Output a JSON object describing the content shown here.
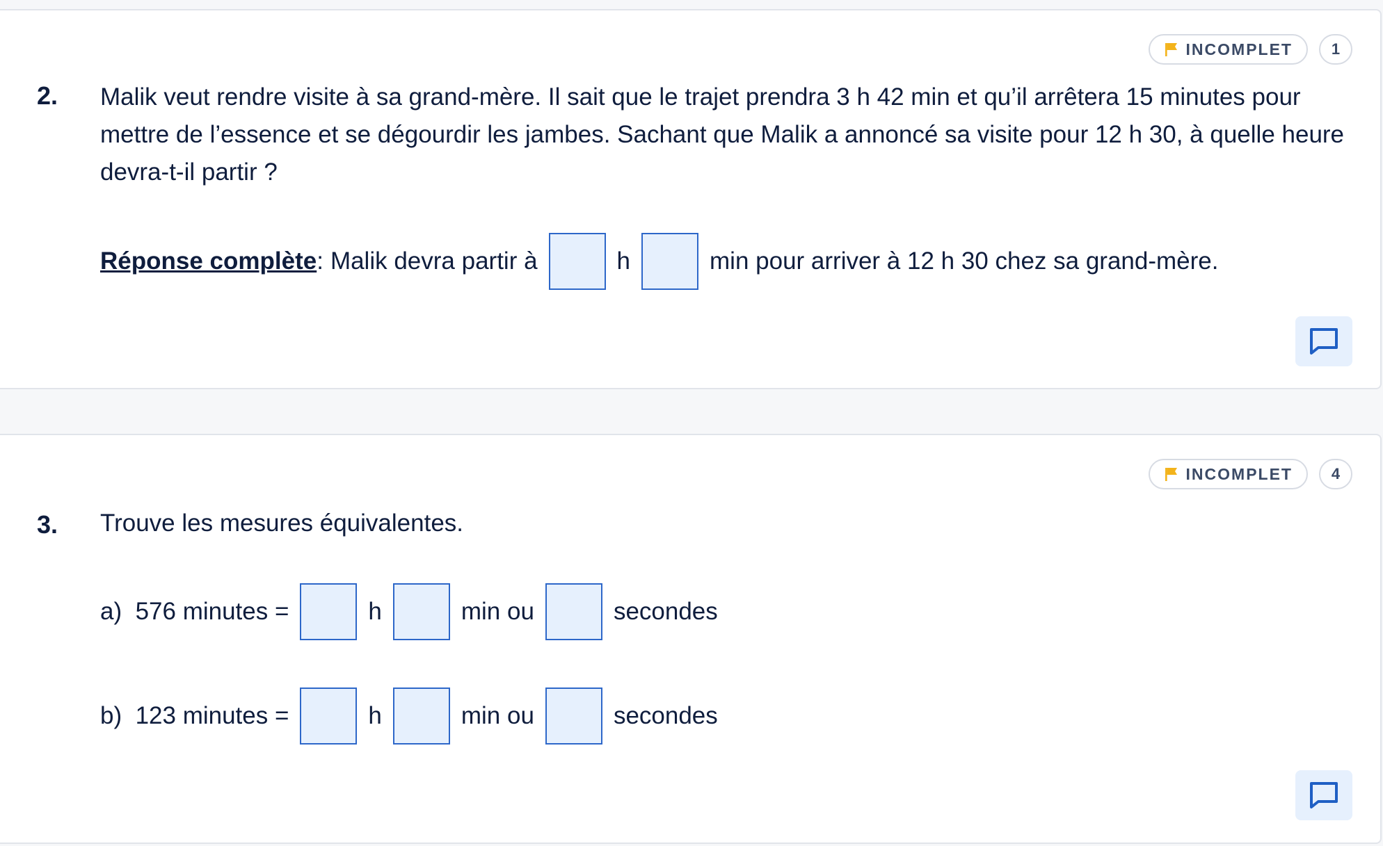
{
  "questions": [
    {
      "number": "2.",
      "status_label": "INCOMPLET",
      "count": "1",
      "text": "Malik veut rendre visite à sa grand-mère. Il sait que le trajet prendra 3 h 42 min et qu’il arrêtera 15 minutes pour mettre de l’essence et se dégourdir les jambes. Sachant que Malik a annoncé sa visite pour 12 h 30, à quelle heure devra-t-il partir ?",
      "answer": {
        "label": "Réponse complète",
        "separator": ":",
        "prefix": "Malik devra partir à",
        "unit_h": "h",
        "suffix": "min pour arriver à 12 h 30 chez sa grand-mère."
      }
    },
    {
      "number": "3.",
      "status_label": "INCOMPLET",
      "count": "4",
      "text": "Trouve les mesures équivalentes.",
      "items": [
        {
          "prefix": "a)  576 minutes =",
          "unit_h": "h",
          "unit_min": "min ou",
          "unit_sec": "secondes"
        },
        {
          "prefix": "b)  123 minutes =",
          "unit_h": "h",
          "unit_min": "min ou",
          "unit_sec": "secondes"
        }
      ]
    }
  ],
  "icons": {
    "status": "flag-icon",
    "comment": "comment-icon"
  },
  "colors": {
    "flag": "#f3b31b",
    "input_border": "#2d67c9",
    "input_fill": "#e6f0fd",
    "text": "#0f1d3d"
  }
}
